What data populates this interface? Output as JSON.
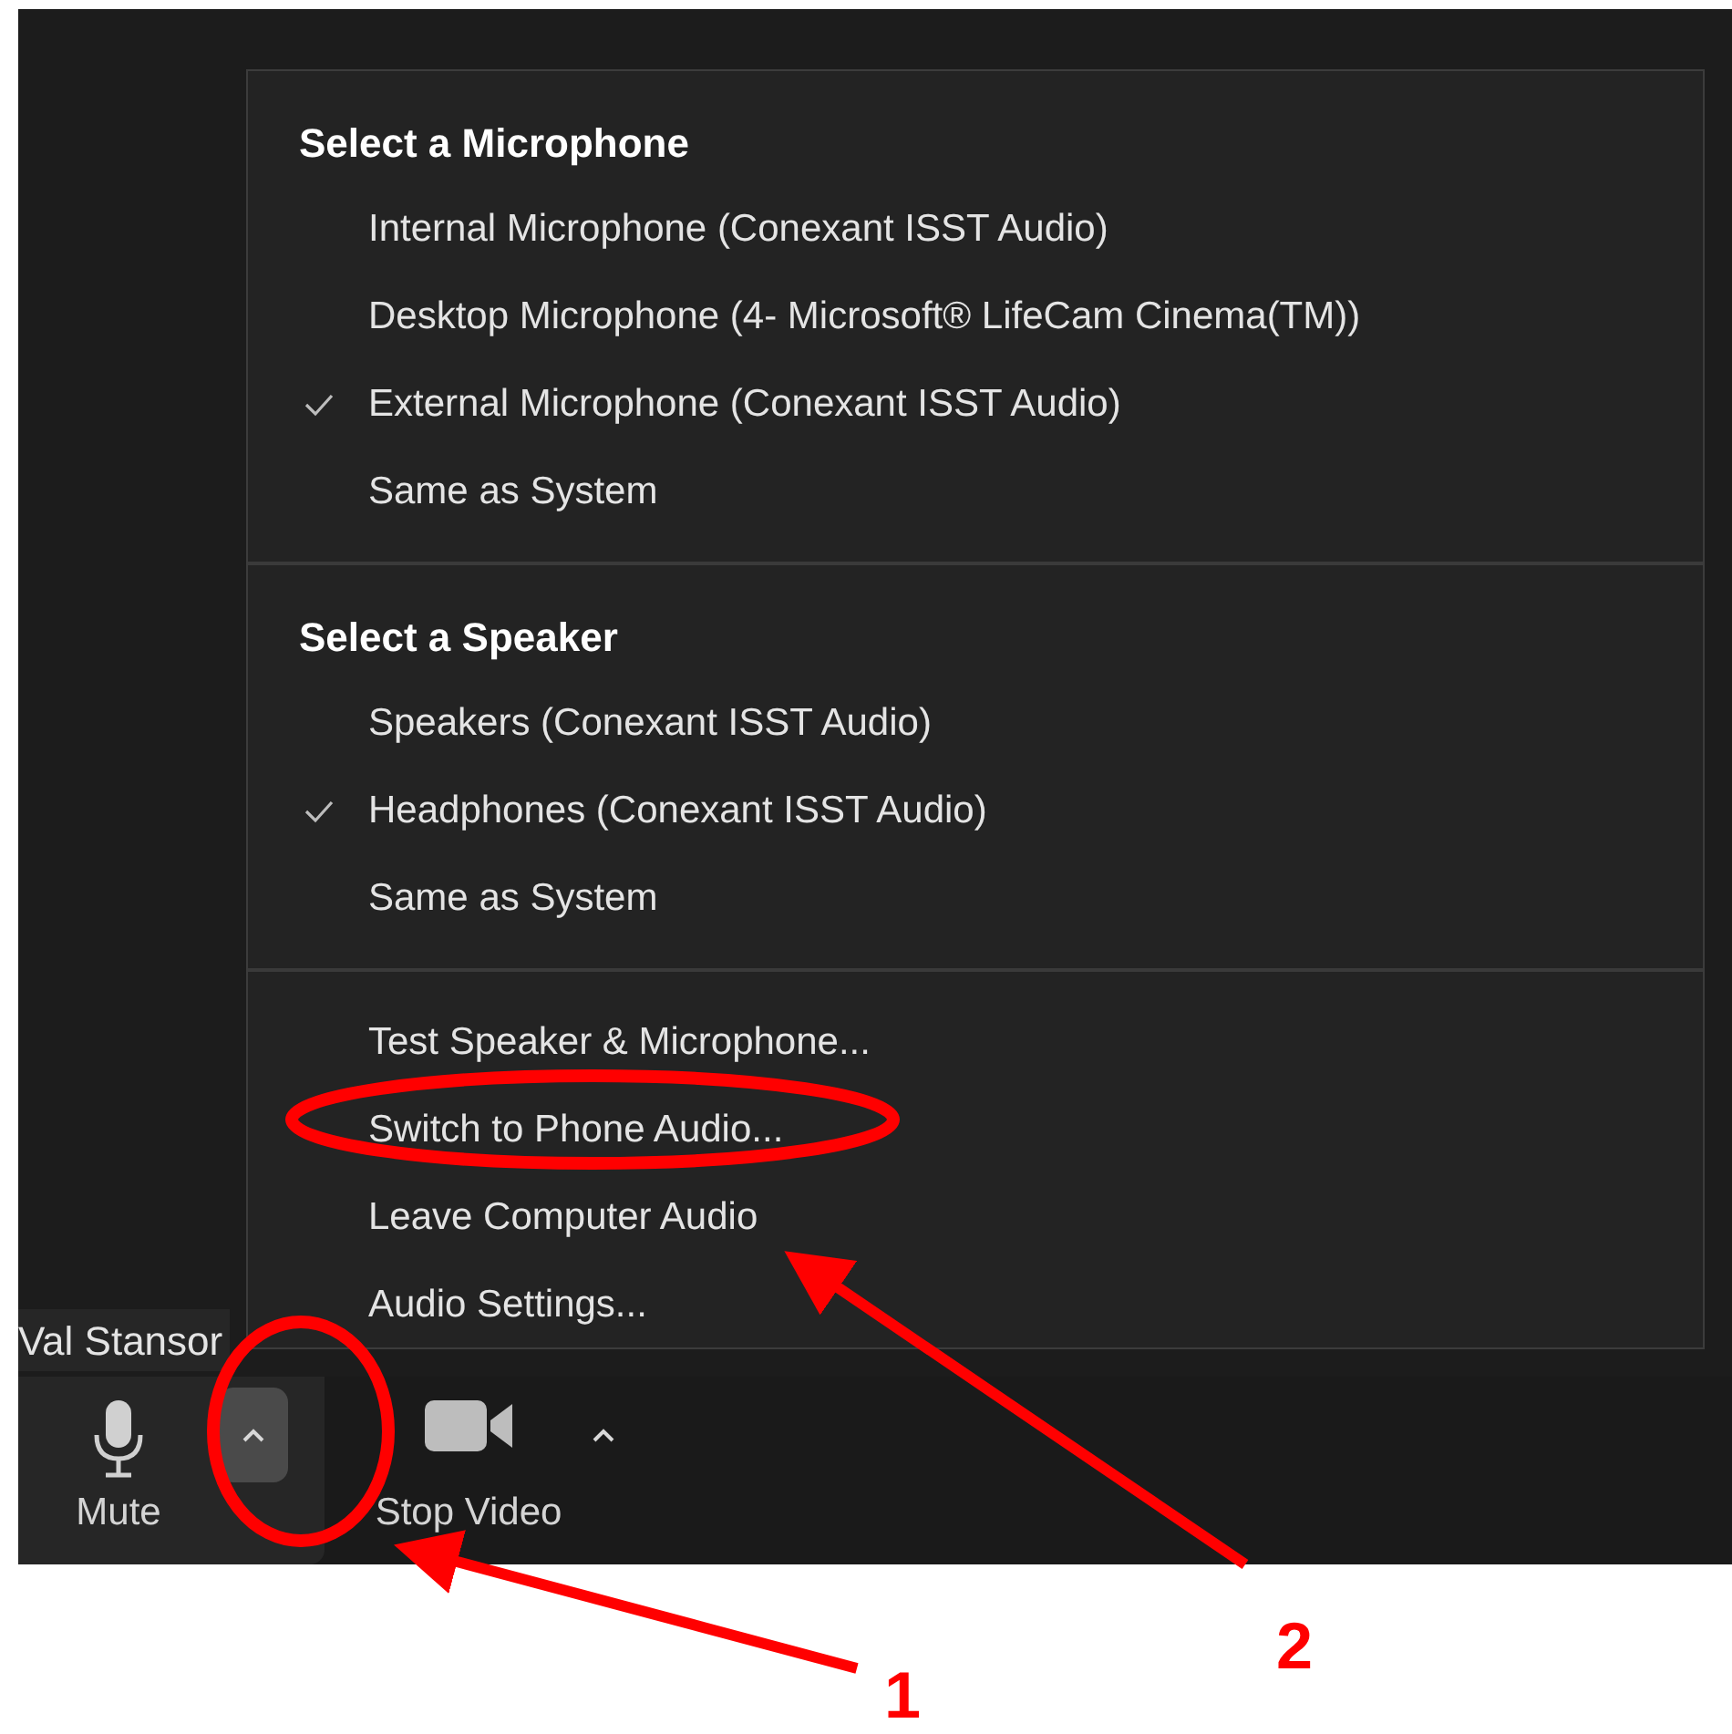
{
  "audio_menu": {
    "sections": [
      {
        "heading": "Select a Microphone",
        "items": [
          {
            "label": "Internal Microphone (Conexant ISST Audio)",
            "checked": false
          },
          {
            "label": "Desktop Microphone (4- Microsoft® LifeCam Cinema(TM))",
            "checked": false
          },
          {
            "label": "External Microphone (Conexant ISST Audio)",
            "checked": true
          },
          {
            "label": "Same as System",
            "checked": false
          }
        ]
      },
      {
        "heading": "Select a Speaker",
        "items": [
          {
            "label": "Speakers (Conexant ISST Audio)",
            "checked": false
          },
          {
            "label": "Headphones (Conexant ISST Audio)",
            "checked": true
          },
          {
            "label": "Same as System",
            "checked": false
          }
        ]
      },
      {
        "items": [
          {
            "label": "Test Speaker & Microphone...",
            "checked": false
          },
          {
            "label": "Switch to Phone Audio...",
            "checked": false
          },
          {
            "label": "Leave Computer Audio",
            "checked": false
          },
          {
            "label": "Audio Settings...",
            "checked": false
          }
        ]
      }
    ]
  },
  "participant_name": "Val Stansor",
  "toolbar": {
    "buttons": [
      {
        "label": "Mute",
        "kind": "mic",
        "menu_open": true
      },
      {
        "label": "Stop Video",
        "kind": "video",
        "menu_open": false
      }
    ]
  },
  "annotations": [
    {
      "number": "1"
    },
    {
      "number": "2"
    }
  ]
}
